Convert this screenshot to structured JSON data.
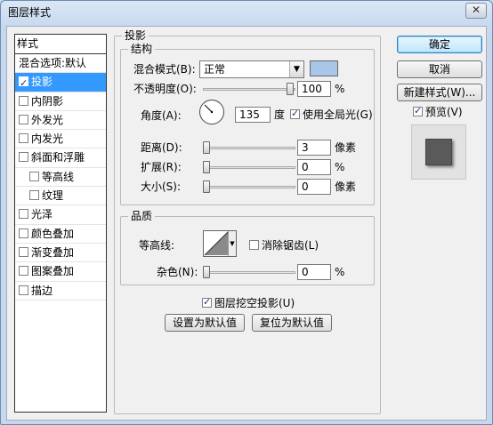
{
  "window": {
    "title": "图层样式",
    "close_label": "✕"
  },
  "styles": {
    "header": "样式",
    "blend_options": "混合选项:默认",
    "items": [
      {
        "label": "投影",
        "checked": true,
        "selected": true,
        "sub": false
      },
      {
        "label": "内阴影",
        "checked": false,
        "selected": false,
        "sub": false
      },
      {
        "label": "外发光",
        "checked": false,
        "selected": false,
        "sub": false
      },
      {
        "label": "内发光",
        "checked": false,
        "selected": false,
        "sub": false
      },
      {
        "label": "斜面和浮雕",
        "checked": false,
        "selected": false,
        "sub": false
      },
      {
        "label": "等高线",
        "checked": false,
        "selected": false,
        "sub": true
      },
      {
        "label": "纹理",
        "checked": false,
        "selected": false,
        "sub": true
      },
      {
        "label": "光泽",
        "checked": false,
        "selected": false,
        "sub": false
      },
      {
        "label": "颜色叠加",
        "checked": false,
        "selected": false,
        "sub": false
      },
      {
        "label": "渐变叠加",
        "checked": false,
        "selected": false,
        "sub": false
      },
      {
        "label": "图案叠加",
        "checked": false,
        "selected": false,
        "sub": false
      },
      {
        "label": "描边",
        "checked": false,
        "selected": false,
        "sub": false
      }
    ]
  },
  "drop_shadow": {
    "title": "投影",
    "structure": {
      "title": "结构",
      "blend_mode_label": "混合模式(B):",
      "blend_mode_value": "正常",
      "shadow_color": "#a8c6e8",
      "opacity_label": "不透明度(O):",
      "opacity_value": "100",
      "opacity_unit": "%",
      "angle_label": "角度(A):",
      "angle_value": "135",
      "angle_unit": "度",
      "global_light_label": "使用全局光(G)",
      "global_light_checked": true,
      "distance_label": "距离(D):",
      "distance_value": "3",
      "distance_unit": "像素",
      "spread_label": "扩展(R):",
      "spread_value": "0",
      "spread_unit": "%",
      "size_label": "大小(S):",
      "size_value": "0",
      "size_unit": "像素"
    },
    "quality": {
      "title": "品质",
      "contour_label": "等高线:",
      "anti_alias_label": "消除锯齿(L)",
      "anti_alias_checked": false,
      "noise_label": "杂色(N):",
      "noise_value": "0",
      "noise_unit": "%"
    },
    "knockout_label": "图层挖空投影(U)",
    "knockout_checked": true,
    "make_default_label": "设置为默认值",
    "reset_default_label": "复位为默认值"
  },
  "buttons": {
    "ok": "确定",
    "cancel": "取消",
    "new_style": "新建样式(W)...",
    "preview_label": "预览(V)",
    "preview_checked": true
  }
}
